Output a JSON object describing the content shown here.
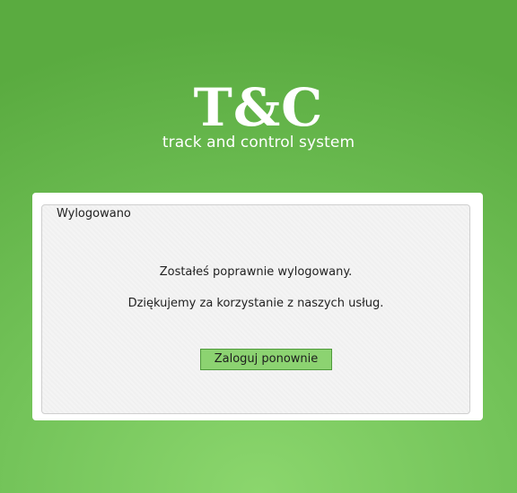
{
  "branding": {
    "logo_text": "T&C",
    "tagline": "track and control system"
  },
  "logout_panel": {
    "legend": "Wylogowano",
    "message_logged_out": "Zostałeś poprawnie wylogowany.",
    "message_thanks": "Dziękujemy za korzystanie z naszych usług.",
    "relogin_button_label": "Zaloguj ponownie"
  },
  "colors": {
    "background_green": "#74c45a",
    "button_green": "#8cd371",
    "panel": "#ffffff"
  }
}
